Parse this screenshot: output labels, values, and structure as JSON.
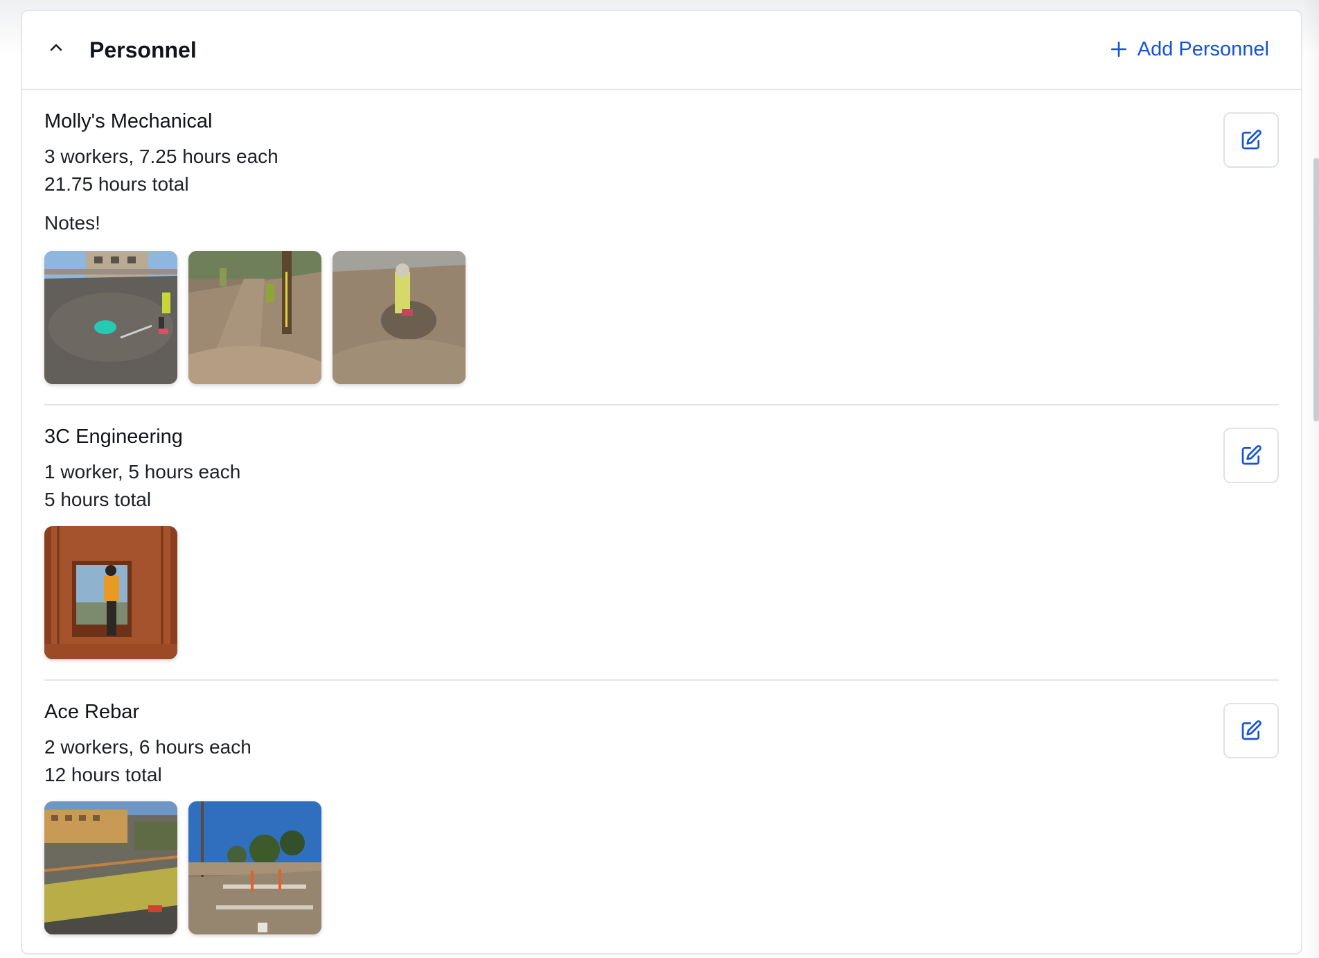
{
  "section": {
    "title": "Personnel",
    "add_label": "Add Personnel",
    "accent": "#1453d6"
  },
  "entries": [
    {
      "company": "Molly's Mechanical",
      "summary": "3 workers, 7.25 hours each",
      "total": "21.75 hours total",
      "notes": "Notes!",
      "photo_count": 3
    },
    {
      "company": "3C Engineering",
      "summary": "1 worker, 5 hours each",
      "total": "5 hours total",
      "photo_count": 1
    },
    {
      "company": "Ace Rebar",
      "summary": "2 workers, 6 hours each",
      "total": "12 hours total",
      "photo_count": 2
    }
  ],
  "icons": {
    "collapse": "chevron-up-icon",
    "add": "plus-icon",
    "edit": "edit-icon"
  }
}
